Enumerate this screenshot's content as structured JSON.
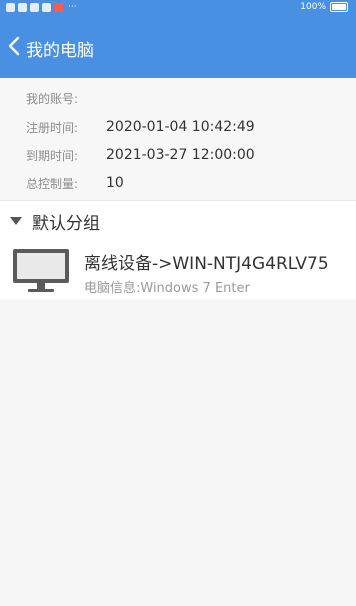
{
  "statusbar": {
    "battery_text": "100%",
    "dots": "···"
  },
  "navbar": {
    "title": "我的电脑"
  },
  "account": {
    "account_label": "我的账号:",
    "account_value": "",
    "register_label": "注册时间:",
    "register_value": "2020-01-04 10:42:49",
    "expire_label": "到期时间:",
    "expire_value": "2021-03-27 12:00:00",
    "control_label": "总控制量:",
    "control_value": "10"
  },
  "group": {
    "label": "默认分组"
  },
  "devices": [
    {
      "title": "离线设备->WIN-NTJ4G4RLV75",
      "info": "电脑信息:Windows 7 Enter"
    }
  ],
  "icons": [
    "back-arrow-icon",
    "triangle-down-icon",
    "monitor-icon",
    "battery-icon"
  ],
  "colors": {
    "accent": "#4a90e2",
    "background": "#f5f5f5",
    "label_gray": "#8c8c8c"
  }
}
